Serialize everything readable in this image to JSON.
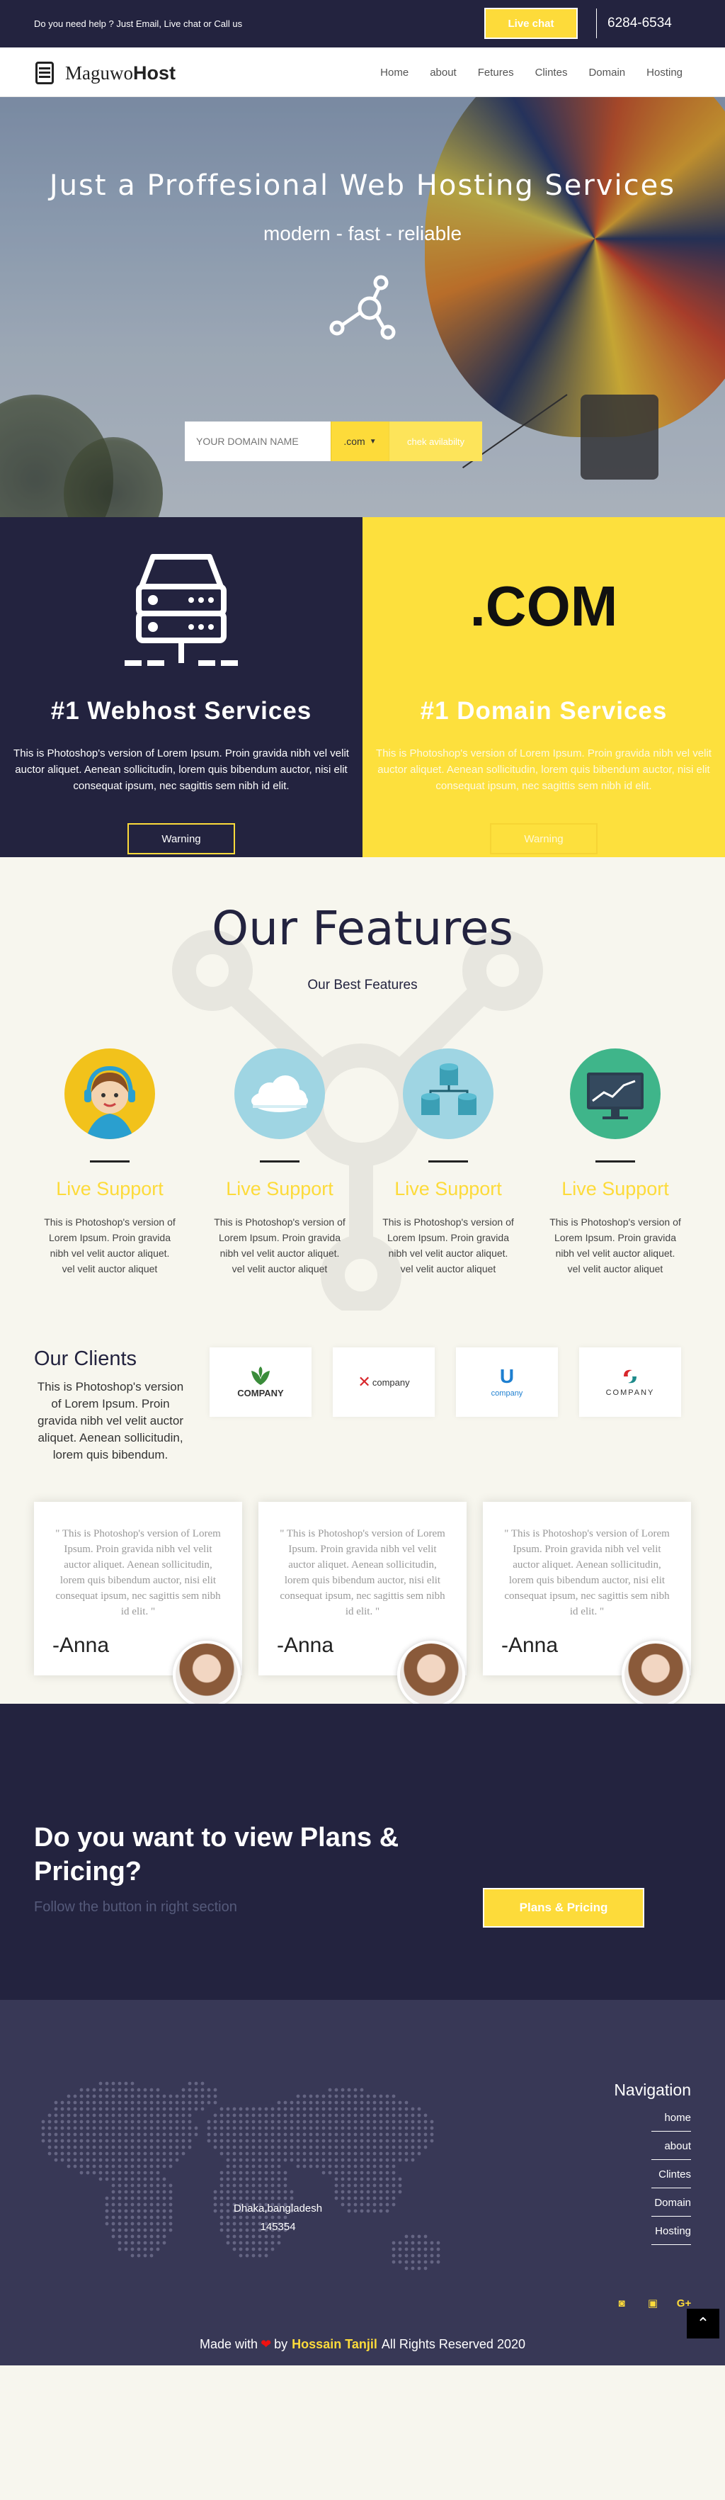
{
  "topbar": {
    "help_text": "Do you need help ? Just Email, Live chat or Call us",
    "live_chat_label": "Live chat",
    "phone": "6284-6534"
  },
  "brand": {
    "name_light": "Maguwo",
    "name_bold": "Host"
  },
  "nav": {
    "items": [
      {
        "label": "Home"
      },
      {
        "label": "about"
      },
      {
        "label": "Fetures"
      },
      {
        "label": "Clintes"
      },
      {
        "label": "Domain"
      },
      {
        "label": "Hosting"
      }
    ]
  },
  "hero": {
    "title": "Just a Proffesional Web Hosting Services",
    "tagline": "modern  -  fast  -  reliable",
    "domain_placeholder": "YOUR DOMAIN NAME",
    "tld": ".com",
    "check_label": "chek avilabilty"
  },
  "services": [
    {
      "title": "#1 Webhost Services",
      "text": "This is Photoshop's version of Lorem Ipsum. Proin gravida nibh vel velit auctor aliquet. Aenean sollicitudin, lorem quis bibendum auctor, nisi elit consequat ipsum, nec sagittis sem nibh id elit.",
      "button": "Warning"
    },
    {
      "big_text": ".COM",
      "title": "#1 Domain Services",
      "text": "This is Photoshop's version of Lorem Ipsum. Proin gravida nibh vel velit auctor aliquet. Aenean sollicitudin, lorem quis bibendum auctor, nisi elit consequat ipsum, nec sagittis sem nibh id elit.",
      "button": "Warning"
    }
  ],
  "features": {
    "title": "Our Features",
    "subtitle": "Our Best Features",
    "items": [
      {
        "icon": "support-agent-icon",
        "title": "Live Support",
        "text": "This is Photoshop's version of Lorem Ipsum. Proin gravida nibh vel velit auctor aliquet. vel velit auctor aliquet"
      },
      {
        "icon": "cloud-icon",
        "title": "Live Support",
        "text": "This is Photoshop's version of Lorem Ipsum. Proin gravida nibh vel velit auctor aliquet. vel velit auctor aliquet"
      },
      {
        "icon": "database-icon",
        "title": "Live Support",
        "text": "This is Photoshop's version of Lorem Ipsum. Proin gravida nibh vel velit auctor aliquet. vel velit auctor aliquet"
      },
      {
        "icon": "monitor-chart-icon",
        "title": "Live Support",
        "text": "This is Photoshop's version of Lorem Ipsum. Proin gravida nibh vel velit auctor aliquet. vel velit auctor aliquet"
      }
    ]
  },
  "clients": {
    "title": "Our Clients",
    "text": "This is Photoshop's version of Lorem Ipsum. Proin gravida nibh vel velit auctor aliquet. Aenean sollicitudin, lorem quis bibendum.",
    "logos": [
      {
        "label": "COMPANY",
        "icon": "leaf-logo-icon"
      },
      {
        "label": "company",
        "icon": "x-logo-icon"
      },
      {
        "label": "company",
        "icon": "u-logo-icon"
      },
      {
        "label": "COMPANY",
        "icon": "swirl-logo-icon"
      }
    ]
  },
  "testimonials": [
    {
      "quote": "\" This is Photoshop's version of Lorem Ipsum. Proin gravida nibh vel velit auctor aliquet. Aenean sollicitudin, lorem quis bibendum auctor, nisi elit consequat ipsum, nec sagittis sem nibh id elit. \"",
      "name": "-Anna"
    },
    {
      "quote": "\" This is Photoshop's version of Lorem Ipsum. Proin gravida nibh vel velit auctor aliquet. Aenean sollicitudin, lorem quis bibendum auctor, nisi elit consequat ipsum, nec sagittis sem nibh id elit. \"",
      "name": "-Anna"
    },
    {
      "quote": "\" This is Photoshop's version of Lorem Ipsum. Proin gravida nibh vel velit auctor aliquet. Aenean sollicitudin, lorem quis bibendum auctor, nisi elit consequat ipsum, nec sagittis sem nibh id elit. \"",
      "name": "-Anna"
    }
  ],
  "plans": {
    "title": "Do you want to view Plans & Pricing?",
    "subtitle": "Follow the button in right section",
    "button": "Plans & Pricing"
  },
  "footer": {
    "address_line1": "Dhaka,bangladesh",
    "address_line2": "145354",
    "nav_title": "Navigation",
    "nav_links": [
      {
        "label": "home"
      },
      {
        "label": "about"
      },
      {
        "label": "Clintes"
      },
      {
        "label": "Domain"
      },
      {
        "label": "Hosting"
      }
    ],
    "social": [
      {
        "icon": "instagram-icon",
        "glyph": "◙"
      },
      {
        "icon": "twitter-icon",
        "glyph": "▣"
      },
      {
        "icon": "google-plus-icon",
        "glyph": "G+"
      }
    ],
    "made_with": "Made with",
    "by": "by",
    "author": "Hossain Tanjil",
    "rights": "All Rights Reserved 2020",
    "to_top_glyph": "⌃"
  },
  "colors": {
    "navy": "#23233f",
    "yellow": "#fddb3a",
    "footer": "#383856",
    "cream": "#f7f6ee"
  }
}
